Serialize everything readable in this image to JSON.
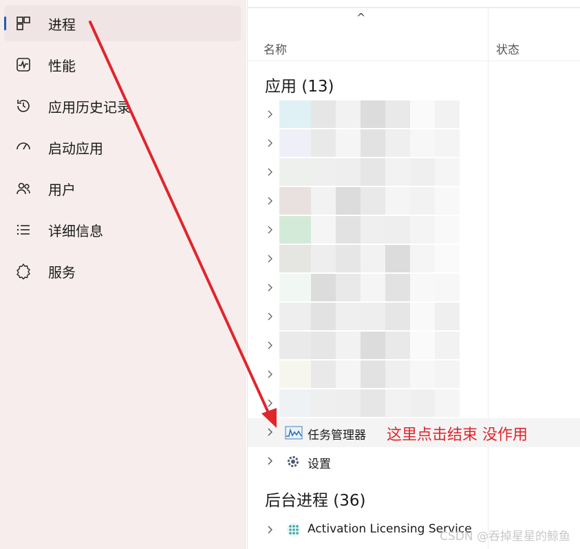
{
  "sidebar": {
    "items": [
      {
        "label": "进程",
        "icon": "processes-icon",
        "active": true
      },
      {
        "label": "性能",
        "icon": "performance-icon"
      },
      {
        "label": "应用历史记录",
        "icon": "app-history-icon"
      },
      {
        "label": "启动应用",
        "icon": "startup-apps-icon"
      },
      {
        "label": "用户",
        "icon": "users-icon"
      },
      {
        "label": "详细信息",
        "icon": "details-icon"
      },
      {
        "label": "服务",
        "icon": "services-icon"
      }
    ]
  },
  "table": {
    "columns": [
      "名称",
      "状态"
    ],
    "sort_indicator": "^"
  },
  "groups": {
    "apps": {
      "title": "应用 (13)"
    },
    "background": {
      "title": "后台进程 (36)"
    }
  },
  "processes": {
    "task_manager": "任务管理器",
    "settings": "设置",
    "activation": "Activation Licensing Service"
  },
  "annotation": "这里点击结束 没作用",
  "watermark": "CSDN @吞掉星星的鲸鱼",
  "colors": {
    "accent": "#1a5fb4",
    "annotation": "#e0252b",
    "sidebar_bg": "#f7eded"
  }
}
